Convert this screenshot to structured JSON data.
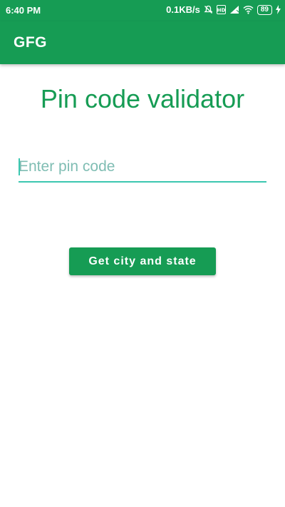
{
  "status_bar": {
    "time": "6:40 PM",
    "network_speed": "0.1KB/s",
    "battery_level": "89",
    "icons": [
      "mute-icon",
      "volte-icon",
      "signal-icon",
      "wifi-icon",
      "battery-icon",
      "charging-icon"
    ]
  },
  "app_bar": {
    "title": "GFG"
  },
  "main": {
    "heading": "Pin code validator",
    "pin_input": {
      "value": "",
      "placeholder": "Enter pin code"
    },
    "button_label": "Get city and state"
  },
  "colors": {
    "primary": "#169c54",
    "accent": "#3bc7b0",
    "background": "#ffffff"
  }
}
